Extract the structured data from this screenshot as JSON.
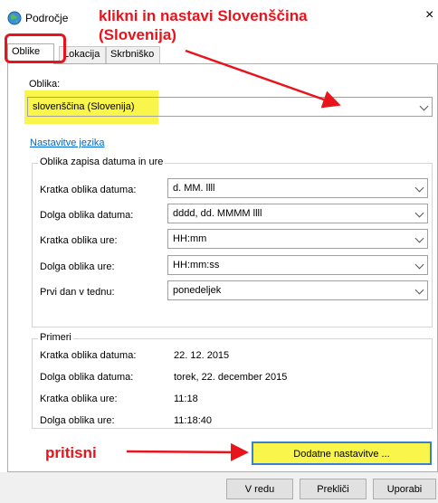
{
  "window": {
    "title": "Področje",
    "icon": "globe-icon",
    "close_symbol": "×"
  },
  "tabs": [
    {
      "label": "Oblike",
      "active": true
    },
    {
      "label": "Lokacija",
      "active": false
    },
    {
      "label": "Skrbniško",
      "active": false
    }
  ],
  "format": {
    "label": "Oblika:",
    "value": "slovenščina (Slovenija)"
  },
  "language_link": "Nastavitve jezika",
  "date_time_group": {
    "title": "Oblika zapisa datuma in ure",
    "rows": [
      {
        "label": "Kratka oblika datuma:",
        "value": "d. MM. llll"
      },
      {
        "label": "Dolga oblika datuma:",
        "value": "dddd, dd. MMMM llll"
      },
      {
        "label": "Kratka oblika ure:",
        "value": "HH:mm"
      },
      {
        "label": "Dolga oblika ure:",
        "value": "HH:mm:ss"
      },
      {
        "label": "Prvi dan v tednu:",
        "value": "ponedeljek"
      }
    ]
  },
  "examples_group": {
    "title": "Primeri",
    "rows": [
      {
        "label": "Kratka oblika datuma:",
        "value": "22. 12. 2015"
      },
      {
        "label": "Dolga oblika datuma:",
        "value": "torek, 22. december 2015"
      },
      {
        "label": "Kratka oblika ure:",
        "value": "11:18"
      },
      {
        "label": "Dolga oblika ure:",
        "value": "11:18:40"
      }
    ]
  },
  "buttons": {
    "additional": "Dodatne nastavitve ...",
    "ok": "V redu",
    "cancel": "Prekliči",
    "apply": "Uporabi"
  },
  "annotations": {
    "top_line1": "klikni in nastavi Slovenščina",
    "top_line2": "(Slovenija)",
    "bottom": "pritisni",
    "color": "#e8141b",
    "highlight_color": "#f9f54a"
  }
}
